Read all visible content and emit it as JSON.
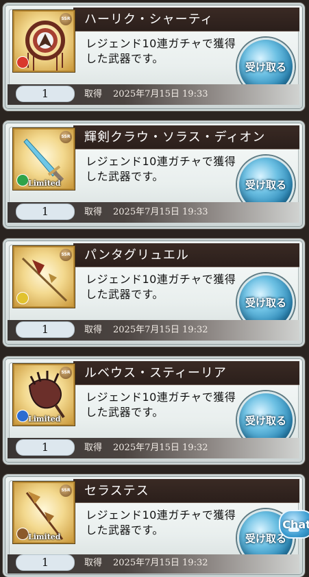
{
  "items": [
    {
      "name": "ハーリク・シャーティ",
      "description": "レジェンド10連ガチャで獲得した武器です。",
      "rarity": "SSR",
      "element_color": "#d9382c",
      "limited_text": "",
      "quantity": "1",
      "acquired_label": "取得",
      "acquired_date": "2025年7月15日 19:33",
      "claim_label": "受け取る"
    },
    {
      "name": "輝剣クラウ・ソラス・ディオン",
      "description": "レジェンド10連ガチャで獲得した武器です。",
      "rarity": "SSR",
      "element_color": "#2fa34a",
      "limited_text": "Limited",
      "quantity": "1",
      "acquired_label": "取得",
      "acquired_date": "2025年7月15日 19:33",
      "claim_label": "受け取る"
    },
    {
      "name": "パンタグリュエル",
      "description": "レジェンド10連ガチャで獲得した武器です。",
      "rarity": "SSR",
      "element_color": "#e1c22f",
      "limited_text": "",
      "quantity": "1",
      "acquired_label": "取得",
      "acquired_date": "2025年7月15日 19:32",
      "claim_label": "受け取る"
    },
    {
      "name": "ルベウス・スティーリア",
      "description": "レジェンド10連ガチャで獲得した武器です。",
      "rarity": "SSR",
      "element_color": "#2c6cd1",
      "limited_text": "Limited",
      "quantity": "1",
      "acquired_label": "取得",
      "acquired_date": "2025年7月15日 19:32",
      "claim_label": "受け取る"
    },
    {
      "name": "セラステス",
      "description": "レジェンド10連ガチャで獲得した武器です。",
      "rarity": "SSR",
      "element_color": "#8b5a2b",
      "limited_text": "Limited",
      "quantity": "1",
      "acquired_label": "取得",
      "acquired_date": "2025年7月15日 19:32",
      "claim_label": "受け取る"
    }
  ],
  "chat": {
    "label": "Chat"
  }
}
